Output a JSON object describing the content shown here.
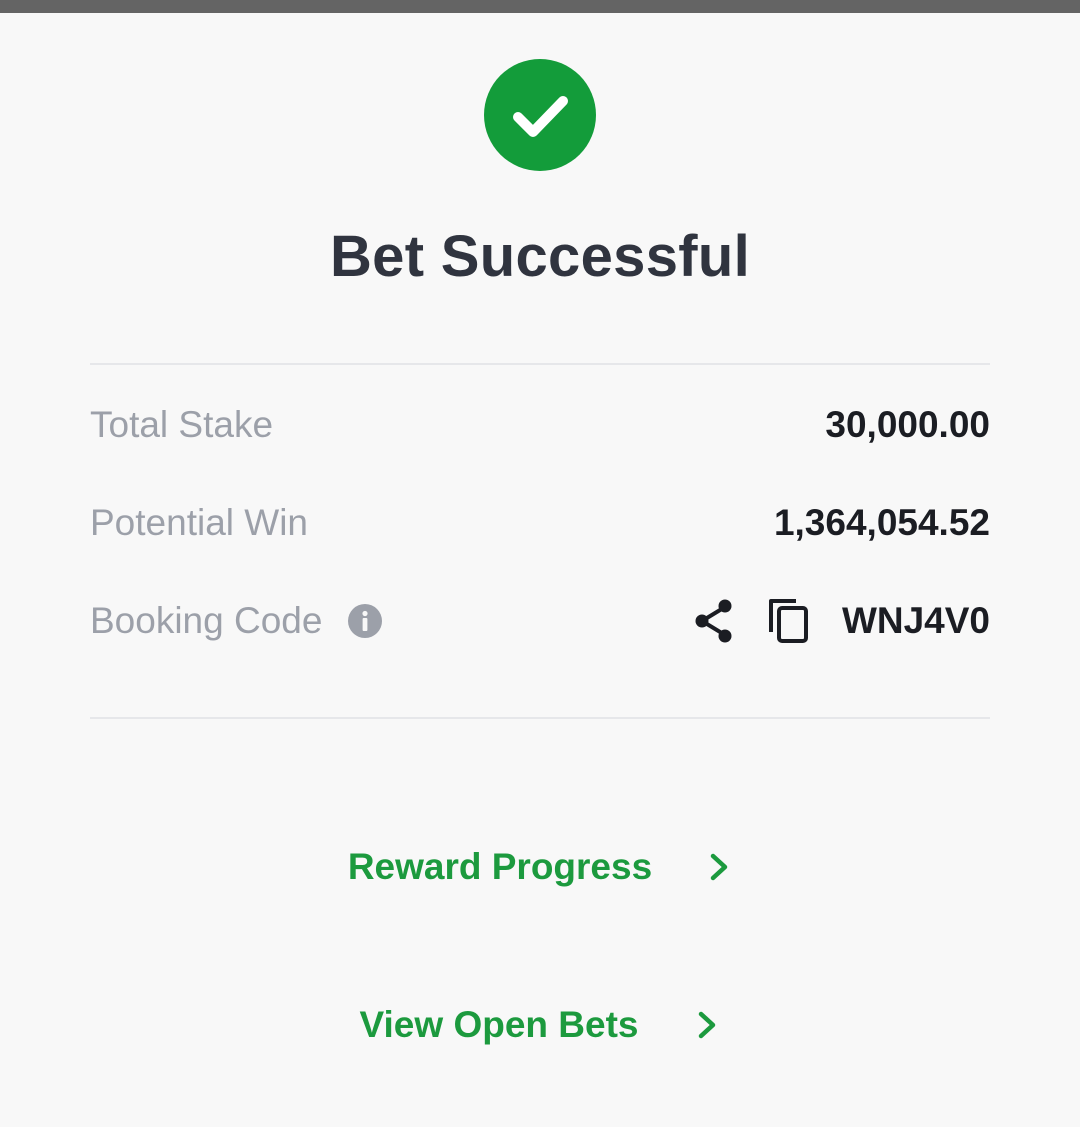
{
  "header": {
    "title": "Bet Successful"
  },
  "summary": {
    "total_stake_label": "Total Stake",
    "total_stake_value": "30,000.00",
    "potential_win_label": "Potential Win",
    "potential_win_value": "1,364,054.52",
    "booking_code_label": "Booking Code",
    "booking_code_value": "WNJ4V0"
  },
  "actions": {
    "reward_progress_label": "Reward Progress",
    "view_open_bets_label": "View Open Bets"
  },
  "icons": {
    "success": "check-circle-icon",
    "info": "info-icon",
    "share": "share-icon",
    "copy": "copy-icon",
    "chevron": "chevron-right-icon"
  },
  "colors": {
    "success_green": "#139c3a",
    "link_green": "#1c9a3e",
    "title": "#30343f",
    "label_gray": "#9ca0a9",
    "value_dark": "#1b1d23",
    "divider": "#e6e7ea",
    "background": "#f8f8f8",
    "status_bar": "#646464"
  }
}
